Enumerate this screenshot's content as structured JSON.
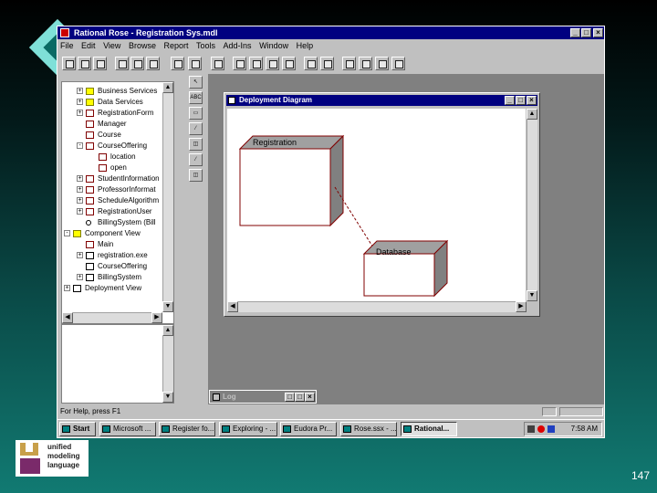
{
  "app": {
    "title": "Rational Rose - Registration Sys.mdl",
    "window_buttons": [
      "_",
      "□",
      "×"
    ]
  },
  "menu": [
    "File",
    "Edit",
    "View",
    "Browse",
    "Report",
    "Tools",
    "Add-Ins",
    "Window",
    "Help"
  ],
  "tree": [
    {
      "label": "Business Services",
      "icon": "folder-icon",
      "expander": "+"
    },
    {
      "label": "Data Services",
      "icon": "folder-icon",
      "expander": "+"
    },
    {
      "label": "RegistrationForm",
      "icon": "class-icon",
      "expander": "+"
    },
    {
      "label": "Manager",
      "icon": "class-icon",
      "expander": ""
    },
    {
      "label": "Course",
      "icon": "class-icon",
      "expander": ""
    },
    {
      "label": "CourseOffering",
      "icon": "class-icon",
      "expander": "-"
    },
    {
      "label": "location",
      "icon": "attribute-icon",
      "expander": ""
    },
    {
      "label": "open",
      "icon": "operation-icon",
      "expander": ""
    },
    {
      "label": "StudentInformation",
      "icon": "class-icon",
      "expander": "+"
    },
    {
      "label": "ProfessorInformat",
      "icon": "class-icon",
      "expander": "+"
    },
    {
      "label": "ScheduleAlgorithm",
      "icon": "class-icon",
      "expander": "+"
    },
    {
      "label": "RegistrationUser",
      "icon": "class-icon",
      "expander": "+"
    },
    {
      "label": "BillingSystem (Bill",
      "icon": "interface-icon",
      "expander": ""
    },
    {
      "label": "Component View",
      "icon": "folder-icon",
      "expander": "-"
    },
    {
      "label": "Main",
      "icon": "main-program-icon",
      "expander": ""
    },
    {
      "label": "registration.exe",
      "icon": "component-icon",
      "expander": "+"
    },
    {
      "label": "CourseOffering",
      "icon": "component-icon",
      "expander": ""
    },
    {
      "label": "BillingSystem",
      "icon": "component-icon",
      "expander": "+"
    },
    {
      "label": "Deployment View",
      "icon": "deployment-icon",
      "expander": "+"
    }
  ],
  "diagram": {
    "title": "Deployment Diagram",
    "nodes": [
      "Registration",
      "Database"
    ]
  },
  "log": {
    "title": "Log"
  },
  "status": {
    "text": "For Help, press F1"
  },
  "taskbar": {
    "start": "Start",
    "tasks": [
      "Microsoft ...",
      "Register fo...",
      "Exploring - ...",
      "Eudora Pr...",
      "Rose.ssx - ...",
      "Rational..."
    ],
    "clock": "7:58 AM"
  },
  "logo": {
    "text": "unified\nmodeling\nlanguage"
  },
  "slide": {
    "page_number": "147"
  },
  "colors": {
    "titlebar": "#000080",
    "node_border": "#800000",
    "node_side": "#808080"
  }
}
